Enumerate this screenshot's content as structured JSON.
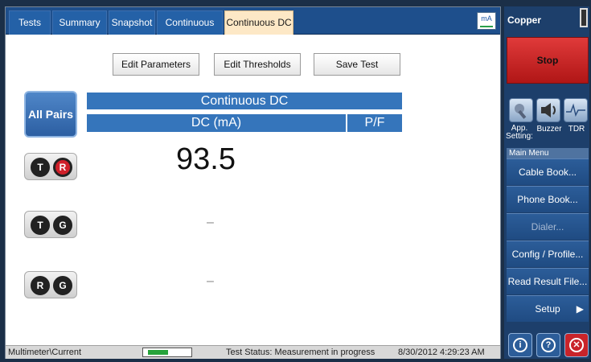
{
  "tabs": [
    {
      "label": "Tests"
    },
    {
      "label": "Summary"
    },
    {
      "label": "Snapshot"
    },
    {
      "label": "Continuous AC"
    },
    {
      "label": "Continuous DC"
    }
  ],
  "unit_icon": "mA",
  "buttons": {
    "edit_parameters": "Edit Parameters",
    "edit_thresholds": "Edit Thresholds",
    "save_test": "Save Test"
  },
  "all_pairs": "All Pairs",
  "table": {
    "title": "Continuous DC",
    "col_dc": "DC (mA)",
    "col_pf": "P/F"
  },
  "pairs": [
    {
      "a": "T",
      "b": "R",
      "value": "93.5"
    },
    {
      "a": "T",
      "b": "G",
      "value": "–"
    },
    {
      "a": "R",
      "b": "G",
      "value": "–"
    }
  ],
  "status": {
    "path": "Multimeter\\Current",
    "progress": 0.5,
    "test_status": "Test Status: Measurement in progress",
    "datetime": "8/30/2012 4:29:23 AM"
  },
  "right_panel": {
    "title": "Copper",
    "stop": "Stop",
    "tools": [
      {
        "icon": "wrench-icon",
        "label": "App. Setting:"
      },
      {
        "icon": "speaker-icon",
        "label": "Buzzer"
      },
      {
        "icon": "waveform-icon",
        "label": "TDR"
      }
    ],
    "menu_title": "Main Menu",
    "menu": [
      {
        "label": "Cable Book...",
        "enabled": true
      },
      {
        "label": "Phone Book...",
        "enabled": true
      },
      {
        "label": "Dialer...",
        "enabled": false
      },
      {
        "label": "Config / Profile...",
        "enabled": true
      },
      {
        "label": "Read Result File...",
        "enabled": true
      },
      {
        "label": "Setup",
        "enabled": true
      }
    ]
  },
  "colors": {
    "accent": "#3575bb",
    "active_tab": "#fde8c6",
    "stop": "#d02a2a"
  }
}
